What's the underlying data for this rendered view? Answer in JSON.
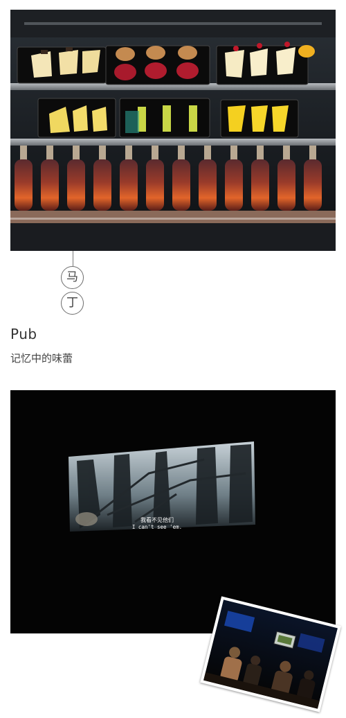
{
  "badge": {
    "char1": "马",
    "char2": "丁"
  },
  "heading": {
    "title": "Pub",
    "subtitle": "记忆中的味蕾"
  },
  "cinema": {
    "subtitle_zh": "我看不见他们",
    "subtitle_en": "I can't see 'em."
  }
}
